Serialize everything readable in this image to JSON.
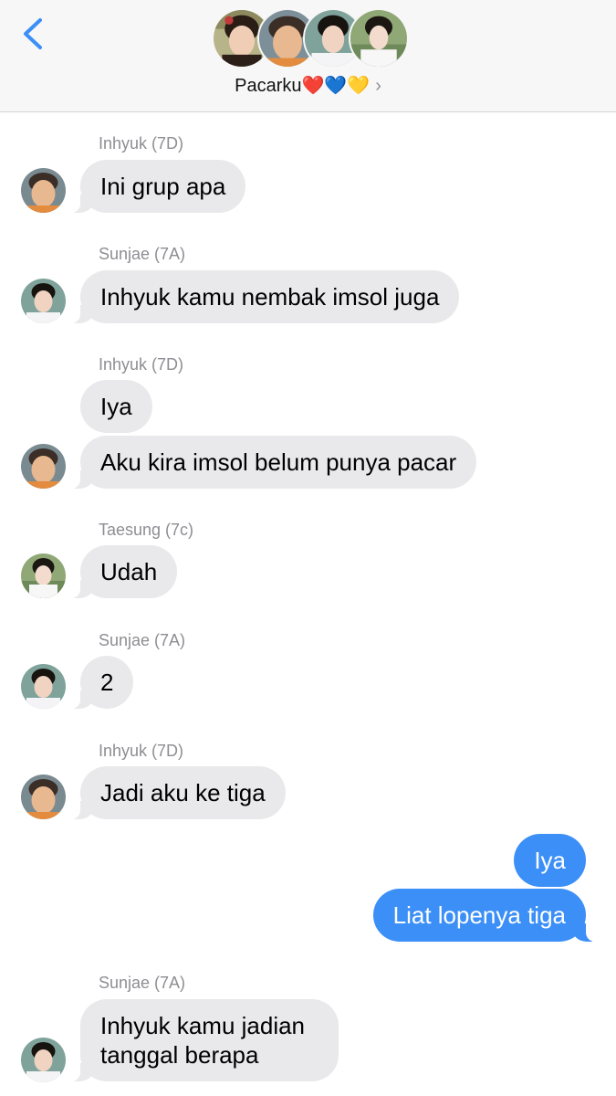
{
  "header": {
    "back_icon": "chevron-left-icon",
    "group_name": "Pacarku",
    "group_hearts": "❤️💙💛",
    "chevron": "›",
    "accent": "#3b8ff7",
    "members": [
      "Inhyuk (7D)",
      "Sunjae (7A)",
      "Taesung (7c)"
    ]
  },
  "messages": [
    {
      "sender": "Inhyuk (7D)",
      "text": "Ini grup apa"
    },
    {
      "sender": "Sunjae (7A)",
      "text": "Inhyuk kamu nembak imsol juga"
    },
    {
      "sender": "Inhyuk (7D)",
      "text": "Iya"
    },
    {
      "text": "Aku kira imsol belum punya pacar"
    },
    {
      "sender": "Taesung (7c)",
      "text": "Udah"
    },
    {
      "sender": "Sunjae (7A)",
      "text": "2"
    },
    {
      "sender": "Inhyuk (7D)",
      "text": "Jadi aku ke tiga"
    },
    {
      "text": "Iya",
      "from_me": true
    },
    {
      "text": "Liat lopenya tiga",
      "from_me": true
    },
    {
      "sender": "Sunjae (7A)",
      "text": "Inhyuk kamu jadian tanggal berapa"
    }
  ],
  "colors": {
    "incoming_bubble": "#e9e9eb",
    "outgoing_bubble": "#3b8ff7",
    "sender_label": "#8e8e93"
  }
}
